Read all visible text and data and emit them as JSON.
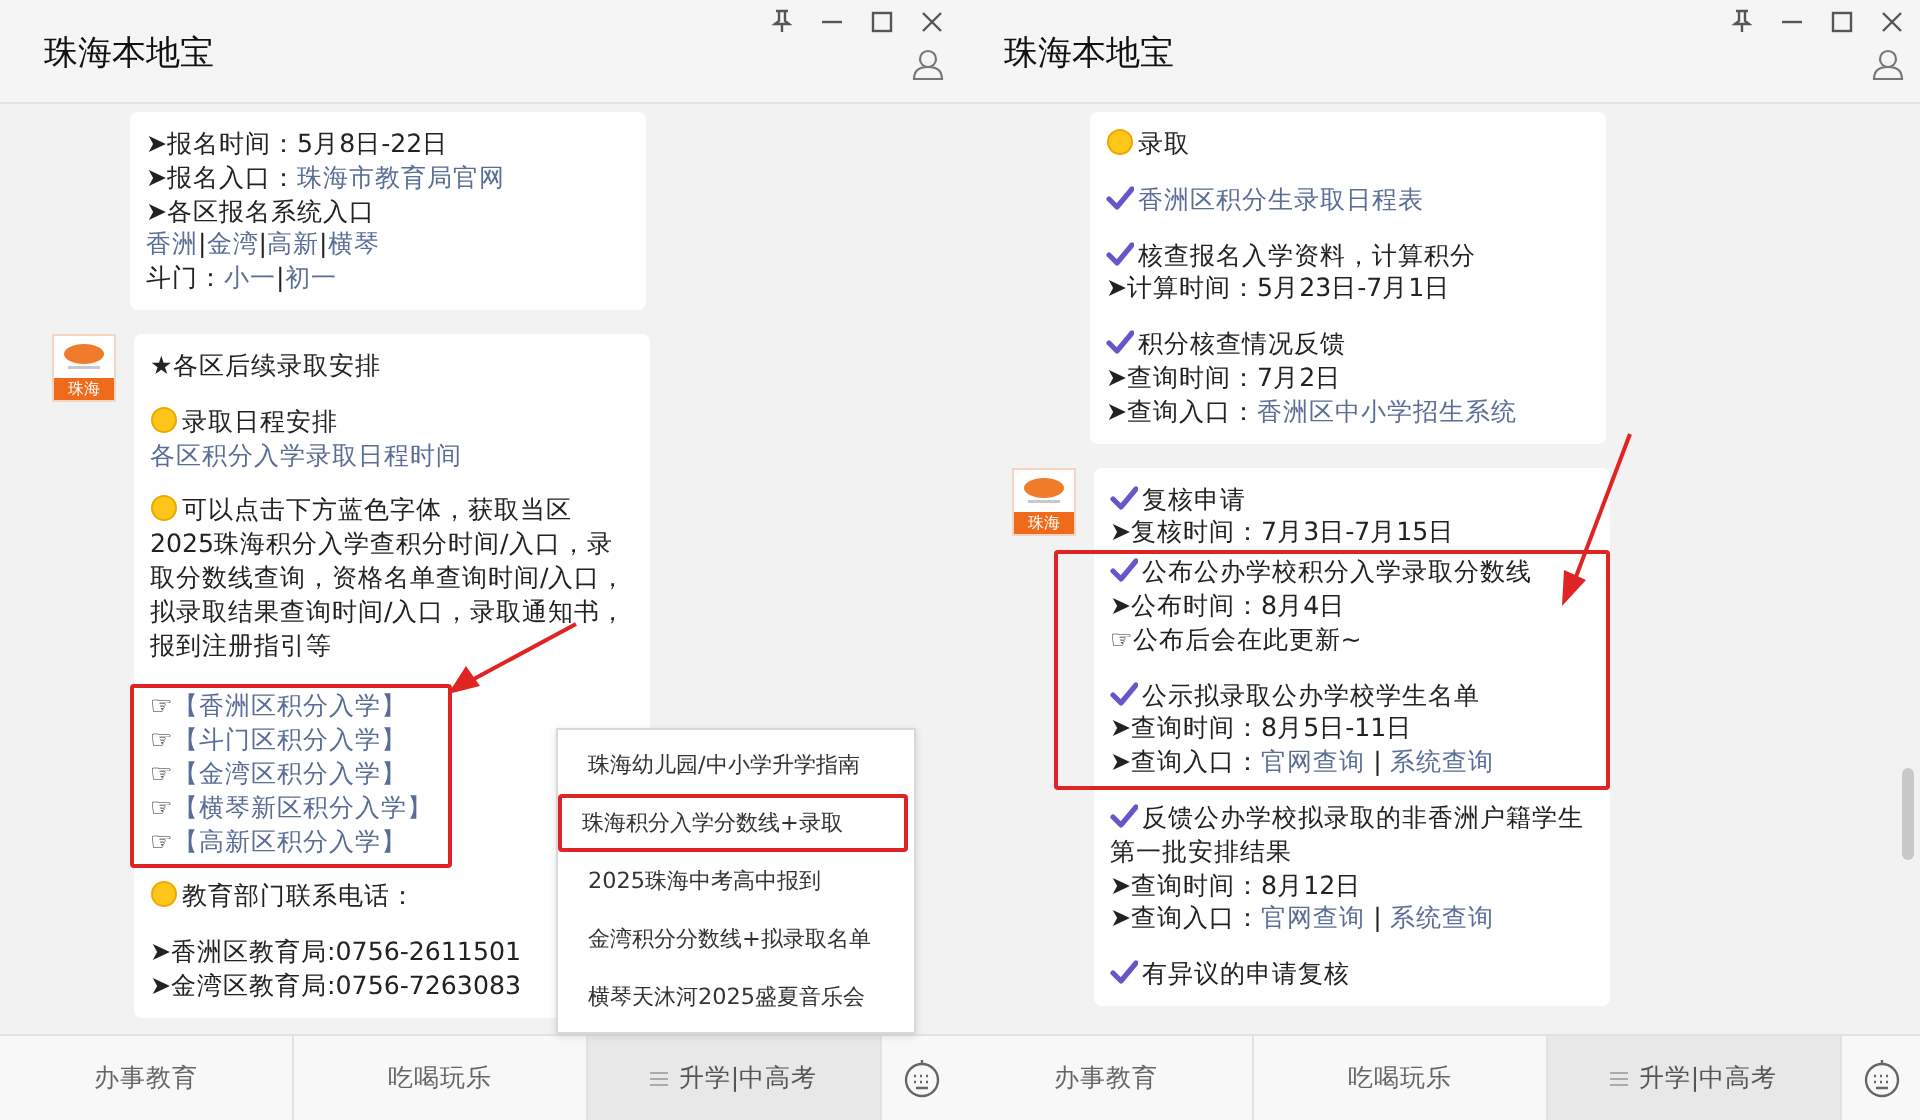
{
  "panels": [
    {
      "title": "珠海本地宝",
      "messages": [
        {
          "lines": [
            {
              "parts": [
                {
                  "text": "➤报名时间：5月8日-22日",
                  "link": false
                }
              ]
            },
            {
              "parts": [
                {
                  "text": "➤报名入口：",
                  "link": false
                },
                {
                  "text": "珠海市教育局官网",
                  "link": true
                }
              ]
            },
            {
              "parts": [
                {
                  "text": "➤各区报名系统入口",
                  "link": false
                }
              ]
            },
            {
              "parts": [
                {
                  "text": "香洲",
                  "link": true
                },
                {
                  "text": "|",
                  "link": false
                },
                {
                  "text": "金湾",
                  "link": true
                },
                {
                  "text": "|",
                  "link": false
                },
                {
                  "text": "高新",
                  "link": true
                },
                {
                  "text": "|",
                  "link": false
                },
                {
                  "text": "横琴",
                  "link": true
                }
              ]
            },
            {
              "parts": [
                {
                  "text": "斗门：",
                  "link": false
                },
                {
                  "text": "小一",
                  "link": true
                },
                {
                  "text": "|",
                  "link": false
                },
                {
                  "text": "初一",
                  "link": true
                }
              ]
            }
          ]
        },
        {
          "avatar_label": "珠海",
          "lines": [
            {
              "parts": [
                {
                  "text": "★各区后续录取安排",
                  "link": false
                }
              ]
            },
            {
              "kind": "spacer"
            },
            {
              "kind": "dot",
              "parts": [
                {
                  "text": "录取日程安排",
                  "link": false
                }
              ]
            },
            {
              "parts": [
                {
                  "text": "各区积分入学录取日程时间",
                  "link": true
                }
              ]
            },
            {
              "kind": "spacer"
            },
            {
              "kind": "dot",
              "parts": [
                {
                  "text": "可以点击下方蓝色字体，获取当区2025珠海积分入学查积分时间/入口，录取分数线查询，资格名单查询时间/入口，拟录取结果查询时间/入口，录取通知书，报到注册指引等",
                  "link": false
                }
              ]
            },
            {
              "kind": "spacer"
            },
            {
              "kind": "group",
              "highlighted": true,
              "arrow": true,
              "lines": [
                {
                  "parts": [
                    {
                      "text": "☞",
                      "link": false
                    },
                    {
                      "text": "【香洲区积分入学】",
                      "link": true
                    }
                  ]
                },
                {
                  "parts": [
                    {
                      "text": "☞",
                      "link": false
                    },
                    {
                      "text": "【斗门区积分入学】",
                      "link": true
                    }
                  ]
                },
                {
                  "parts": [
                    {
                      "text": "☞",
                      "link": false
                    },
                    {
                      "text": "【金湾区积分入学】",
                      "link": true
                    }
                  ]
                },
                {
                  "parts": [
                    {
                      "text": "☞",
                      "link": false
                    },
                    {
                      "text": "【横琴新区积分入学】",
                      "link": true
                    }
                  ]
                },
                {
                  "parts": [
                    {
                      "text": "☞",
                      "link": false
                    },
                    {
                      "text": "【高新区积分入学】",
                      "link": true
                    }
                  ]
                }
              ]
            },
            {
              "kind": "dot",
              "parts": [
                {
                  "text": "教育部门联系电话：",
                  "link": false
                }
              ]
            },
            {
              "kind": "spacer"
            },
            {
              "parts": [
                {
                  "text": "➤香洲区教育局:0756-2611501",
                  "link": false
                }
              ]
            },
            {
              "parts": [
                {
                  "text": "➤金湾区教育局:0756-7263083",
                  "link": false
                }
              ]
            }
          ]
        }
      ],
      "menu_bar": [
        {
          "label": "办事教育",
          "selected": false,
          "has_menu": false
        },
        {
          "label": "吃喝玩乐",
          "selected": false,
          "has_menu": false
        },
        {
          "label": "升学|中高考",
          "selected": true,
          "has_menu": true
        }
      ],
      "popup": [
        {
          "label": "珠海幼儿园/中小学升学指南",
          "highlighted": false
        },
        {
          "label": "珠海积分入学分数线+录取",
          "highlighted": true
        },
        {
          "label": "2025珠海中考高中报到",
          "highlighted": false
        },
        {
          "label": "金湾积分分数线+拟录取名单",
          "highlighted": false
        },
        {
          "label": "横琴天沐河2025盛夏音乐会",
          "highlighted": false
        }
      ]
    },
    {
      "title": "珠海本地宝",
      "scrollbar": true,
      "messages": [
        {
          "lines": [
            {
              "kind": "dot",
              "parts": [
                {
                  "text": "录取",
                  "link": false
                }
              ]
            },
            {
              "kind": "spacer"
            },
            {
              "kind": "check",
              "parts": [
                {
                  "text": "香洲区积分生录取日程表",
                  "link": true
                }
              ]
            },
            {
              "kind": "spacer"
            },
            {
              "kind": "check",
              "parts": [
                {
                  "text": "核查报名入学资料，计算积分",
                  "link": false
                }
              ]
            },
            {
              "parts": [
                {
                  "text": "➤计算时间：5月23日-7月1日",
                  "link": false
                }
              ]
            },
            {
              "kind": "spacer"
            },
            {
              "kind": "check",
              "parts": [
                {
                  "text": "积分核查情况反馈",
                  "link": false
                }
              ]
            },
            {
              "parts": [
                {
                  "text": "➤查询时间：7月2日",
                  "link": false
                }
              ]
            },
            {
              "parts": [
                {
                  "text": "➤查询入口：",
                  "link": false
                },
                {
                  "text": "香洲区中小学招生系统",
                  "link": true
                }
              ]
            }
          ]
        },
        {
          "avatar_label": "珠海",
          "lines": [
            {
              "kind": "check",
              "parts": [
                {
                  "text": "复核申请",
                  "link": false
                }
              ]
            },
            {
              "parts": [
                {
                  "text": "➤复核时间：7月3日-7月15日",
                  "link": false
                }
              ]
            },
            {
              "kind": "group",
              "highlighted": true,
              "arrow": true,
              "lines": [
                {
                  "kind": "check",
                  "parts": [
                    {
                      "text": "公布公办学校积分入学录取分数线",
                      "link": false
                    }
                  ]
                },
                {
                  "parts": [
                    {
                      "text": "➤公布时间：8月4日",
                      "link": false
                    }
                  ]
                },
                {
                  "parts": [
                    {
                      "text": "☞公布后会在此更新~",
                      "link": false
                    }
                  ]
                },
                {
                  "kind": "spacer"
                },
                {
                  "kind": "check",
                  "parts": [
                    {
                      "text": "公示拟录取公办学校学生名单",
                      "link": false
                    }
                  ]
                },
                {
                  "parts": [
                    {
                      "text": "➤查询时间：8月5日-11日",
                      "link": false
                    }
                  ]
                },
                {
                  "parts": [
                    {
                      "text": "➤查询入口：",
                      "link": false
                    },
                    {
                      "text": "官网查询",
                      "link": true
                    },
                    {
                      "text": " | ",
                      "link": false
                    },
                    {
                      "text": "系统查询",
                      "link": true
                    }
                  ]
                }
              ]
            },
            {
              "kind": "check",
              "parts": [
                {
                  "text": "反馈公办学校拟录取的非香洲户籍学生第一批安排结果",
                  "link": false
                }
              ]
            },
            {
              "parts": [
                {
                  "text": "➤查询时间：8月12日",
                  "link": false
                }
              ]
            },
            {
              "parts": [
                {
                  "text": "➤查询入口：",
                  "link": false
                },
                {
                  "text": "官网查询",
                  "link": true
                },
                {
                  "text": " | ",
                  "link": false
                },
                {
                  "text": "系统查询",
                  "link": true
                }
              ]
            },
            {
              "kind": "spacer"
            },
            {
              "kind": "check",
              "parts": [
                {
                  "text": "有异议的申请复核",
                  "link": false
                }
              ]
            }
          ]
        }
      ],
      "menu_bar": [
        {
          "label": "办事教育",
          "selected": false,
          "has_menu": false
        },
        {
          "label": "吃喝玩乐",
          "selected": false,
          "has_menu": false
        },
        {
          "label": "升学|中高考",
          "selected": true,
          "has_menu": true
        }
      ]
    }
  ]
}
